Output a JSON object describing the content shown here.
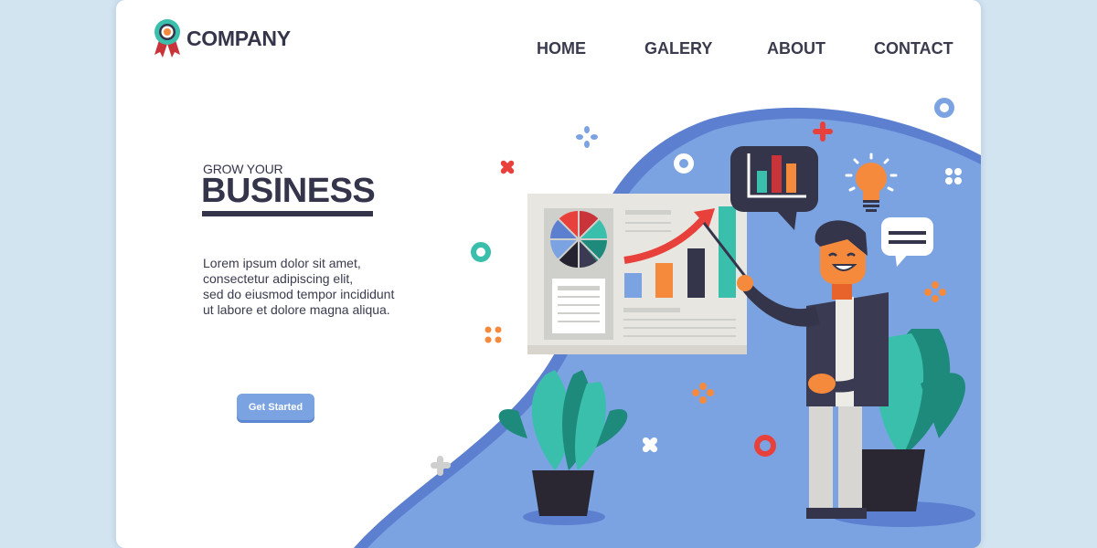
{
  "brand": {
    "name": "COMPANY"
  },
  "nav": {
    "items": [
      "HOME",
      "GALERY",
      "ABOUT",
      "CONTACT"
    ]
  },
  "hero": {
    "kicker": "GROW YOUR",
    "title": "BUSINESS",
    "description": [
      "Lorem ipsum dolor sit amet,",
      "consectetur adipiscing elit,",
      "sed do eiusmod tempor incididunt",
      "ut labore et dolore magna aliqua."
    ],
    "cta_label": "Get Started"
  },
  "colors": {
    "page_bg": "#d3e4f1",
    "text_dark": "#34354a",
    "accent_blue": "#7ba3e2",
    "blob_edge": "#5c7fd0",
    "teal": "#3bbfad",
    "red": "#e8413c",
    "orange": "#f58a3d"
  }
}
